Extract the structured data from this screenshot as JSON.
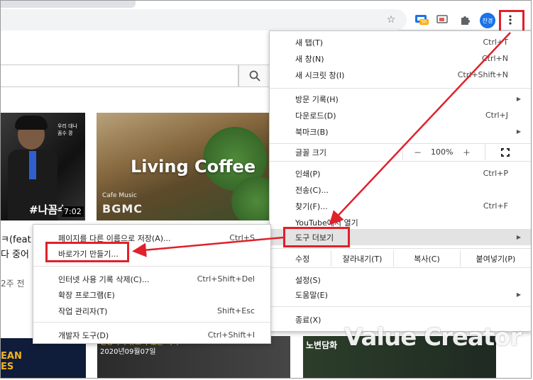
{
  "toolbar": {
    "avatar_label": "찬경",
    "ext_badge": "9h",
    "icons": [
      "star-icon",
      "extension-badge-icon",
      "cast-icon",
      "puzzle-icon",
      "avatar",
      "more-vert-icon"
    ]
  },
  "youtube": {
    "video1_hashtag": "#나꼼수",
    "video1_small_text": "우리 대나\n꼼수 콩",
    "video1_duration": "7:02",
    "video2_title": "Living Coffee",
    "video2_cafe": "Cafe Music",
    "video2_bgm": "BGMC",
    "title_frag1": "ㅋ(feat",
    "title_frag2": "다 중어",
    "meta_frag": "2주 전",
    "bottom_a_text": "EAN\nES",
    "bottom_b_line1": "변상욱의 뉴스가 있는 저녁",
    "bottom_b_line2": "2020년09월07일",
    "bottom_c_text": "노변담화"
  },
  "watermark": "Value Creator",
  "menu": {
    "new_tab": {
      "label": "새 탭(T)",
      "shortcut": "Ctrl+T"
    },
    "new_window": {
      "label": "새 창(N)",
      "shortcut": "Ctrl+N"
    },
    "incognito": {
      "label": "새 시크릿 창(I)",
      "shortcut": "Ctrl+Shift+N"
    },
    "history": {
      "label": "방문 기록(H)"
    },
    "downloads": {
      "label": "다운로드(D)",
      "shortcut": "Ctrl+J"
    },
    "bookmarks": {
      "label": "북마크(B)"
    },
    "zoom": {
      "label": "글꼴 크기",
      "minus": "－",
      "value": "100%",
      "plus": "＋"
    },
    "print": {
      "label": "인쇄(P)",
      "shortcut": "Ctrl+P"
    },
    "cast": {
      "label": "전송(C)..."
    },
    "find": {
      "label": "찾기(F)...",
      "shortcut": "Ctrl+F"
    },
    "open_in_youtube": {
      "label": "YouTube에서 열기"
    },
    "more_tools": {
      "label": "도구 더보기"
    },
    "edit": {
      "label": "수정",
      "cut": "잘라내기(T)",
      "copy": "복사(C)",
      "paste": "붙여넣기(P)"
    },
    "settings": {
      "label": "설정(S)"
    },
    "help": {
      "label": "도움말(E)"
    },
    "exit": {
      "label": "종료(X)"
    }
  },
  "submenu": {
    "save_page": {
      "label": "페이지를 다른 이름으로 저장(A)...",
      "shortcut": "Ctrl+S"
    },
    "create_shortcut": {
      "label": "바로가기 만들기..."
    },
    "clear_data": {
      "label": "인터넷 사용 기록 삭제(C)...",
      "shortcut": "Ctrl+Shift+Del"
    },
    "extensions": {
      "label": "확장 프로그램(E)"
    },
    "task_manager": {
      "label": "작업 관리자(T)",
      "shortcut": "Shift+Esc"
    },
    "dev_tools": {
      "label": "개발자 도구(D)",
      "shortcut": "Ctrl+Shift+I"
    }
  },
  "colors": {
    "annotation_red": "#e0202a",
    "menu_highlight": "#e3e3e3",
    "avatar_blue": "#1a73e8"
  }
}
